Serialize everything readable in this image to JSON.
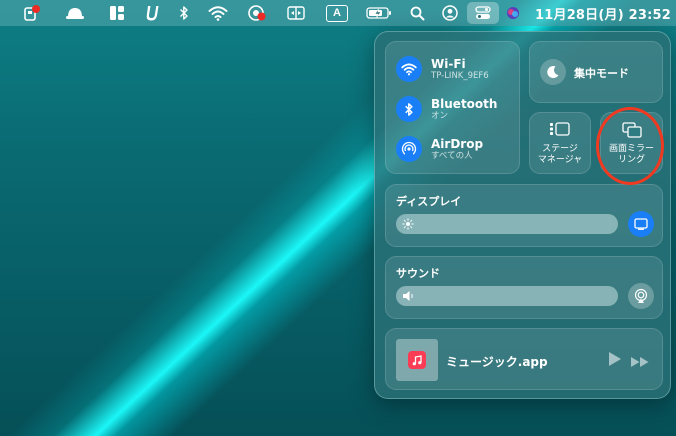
{
  "menubar": {
    "clock": "11月28日(月)  23:52",
    "input_source": "A",
    "icons": [
      "notification-app-icon",
      "hat-icon",
      "layout-app-icon",
      "u-app-icon",
      "bluetooth-icon",
      "wifi-icon",
      "record-app-icon",
      "screen-mirror-app-icon",
      "input-source-icon",
      "battery-icon",
      "search-icon",
      "user-icon",
      "control-center-icon",
      "siri-icon"
    ]
  },
  "control_center": {
    "wifi": {
      "title": "Wi-Fi",
      "subtitle": "TP-LINK_9EF6"
    },
    "bluetooth": {
      "title": "Bluetooth",
      "subtitle": "オン"
    },
    "airdrop": {
      "title": "AirDrop",
      "subtitle": "すべての人"
    },
    "focus": {
      "label": "集中モード"
    },
    "stage_manager": {
      "label_line1": "ステージ",
      "label_line2": "マネージャ"
    },
    "screen_mirroring": {
      "label_line1": "画面ミラー",
      "label_line2": "リング"
    },
    "display": {
      "title": "ディスプレイ"
    },
    "sound": {
      "title": "サウンド"
    },
    "now_playing": {
      "app": "ミュージック.app"
    }
  },
  "colors": {
    "accent": "#1a7ff7",
    "highlight_ring": "#ef3a21",
    "music": "#fa3c55"
  }
}
